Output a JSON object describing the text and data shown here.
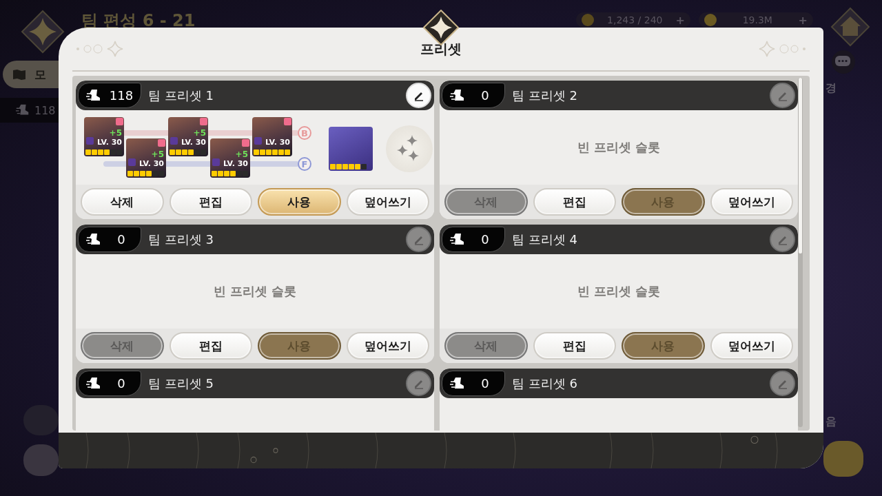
{
  "background": {
    "title": "팀 편성 6 - 21",
    "resources": [
      {
        "kind": "stamina",
        "value": "1,243 / 240",
        "action": "+"
      },
      {
        "kind": "gold",
        "value": "19.3M",
        "action": "+"
      }
    ],
    "left_texts": [
      "모",
      "118"
    ],
    "right_texts": [
      "경",
      "음"
    ]
  },
  "modal": {
    "title": "프리셋",
    "presets": [
      {
        "power": "118",
        "name": "팀 프리셋 1",
        "edit_enabled": true,
        "empty": false,
        "lines": [
          "B",
          "F"
        ],
        "heroes": [
          {
            "level": "LV. 30",
            "bonus": "+5",
            "stars": 4
          },
          {
            "level": "LV. 30",
            "bonus": "+5",
            "stars": 4
          },
          {
            "level": "LV. 30",
            "bonus": "+5",
            "stars": 4
          },
          {
            "level": "LV. 30",
            "bonus": "+5",
            "stars": 4
          },
          {
            "level": "LV. 30",
            "stars": 6
          }
        ],
        "pet": {
          "stars": 5
        },
        "buttons": [
          {
            "kind": "delete",
            "label": "삭제",
            "disabled": false
          },
          {
            "kind": "edit",
            "label": "편집",
            "disabled": false
          },
          {
            "kind": "use",
            "label": "사용",
            "disabled": false
          },
          {
            "kind": "overwrite",
            "label": "덮어쓰기",
            "disabled": false
          }
        ]
      },
      {
        "power": "0",
        "name": "팀 프리셋 2",
        "edit_enabled": false,
        "empty": true,
        "empty_text": "빈 프리셋 슬롯",
        "buttons": [
          {
            "kind": "delete",
            "label": "삭제",
            "disabled": true
          },
          {
            "kind": "edit",
            "label": "편집",
            "disabled": false
          },
          {
            "kind": "use",
            "label": "사용",
            "disabled": true
          },
          {
            "kind": "overwrite",
            "label": "덮어쓰기",
            "disabled": false
          }
        ]
      },
      {
        "power": "0",
        "name": "팀 프리셋 3",
        "edit_enabled": false,
        "empty": true,
        "empty_text": "빈 프리셋 슬롯",
        "buttons": [
          {
            "kind": "delete",
            "label": "삭제",
            "disabled": true
          },
          {
            "kind": "edit",
            "label": "편집",
            "disabled": false
          },
          {
            "kind": "use",
            "label": "사용",
            "disabled": true
          },
          {
            "kind": "overwrite",
            "label": "덮어쓰기",
            "disabled": false
          }
        ]
      },
      {
        "power": "0",
        "name": "팀 프리셋 4",
        "edit_enabled": false,
        "empty": true,
        "empty_text": "빈 프리셋 슬롯",
        "buttons": [
          {
            "kind": "delete",
            "label": "삭제",
            "disabled": true
          },
          {
            "kind": "edit",
            "label": "편집",
            "disabled": false
          },
          {
            "kind": "use",
            "label": "사용",
            "disabled": true
          },
          {
            "kind": "overwrite",
            "label": "덮어쓰기",
            "disabled": false
          }
        ]
      },
      {
        "power": "0",
        "name": "팀 프리셋 5",
        "edit_enabled": false,
        "empty": true
      },
      {
        "power": "0",
        "name": "팀 프리셋 6",
        "edit_enabled": false,
        "empty": true
      }
    ]
  }
}
